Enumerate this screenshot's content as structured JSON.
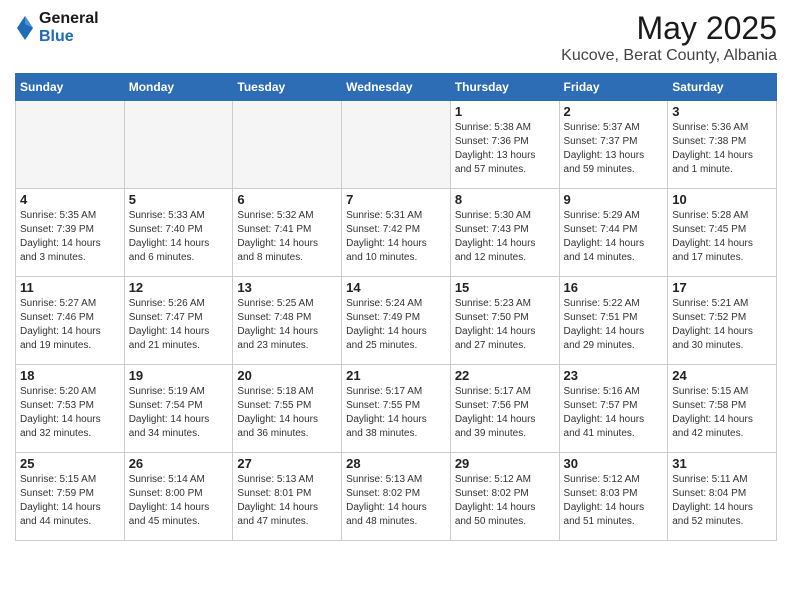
{
  "logo": {
    "general": "General",
    "blue": "Blue"
  },
  "title": {
    "month": "May 2025",
    "location": "Kucove, Berat County, Albania"
  },
  "days_of_week": [
    "Sunday",
    "Monday",
    "Tuesday",
    "Wednesday",
    "Thursday",
    "Friday",
    "Saturday"
  ],
  "weeks": [
    [
      {
        "day": "",
        "info": ""
      },
      {
        "day": "",
        "info": ""
      },
      {
        "day": "",
        "info": ""
      },
      {
        "day": "",
        "info": ""
      },
      {
        "day": "1",
        "info": "Sunrise: 5:38 AM\nSunset: 7:36 PM\nDaylight: 13 hours and 57 minutes."
      },
      {
        "day": "2",
        "info": "Sunrise: 5:37 AM\nSunset: 7:37 PM\nDaylight: 13 hours and 59 minutes."
      },
      {
        "day": "3",
        "info": "Sunrise: 5:36 AM\nSunset: 7:38 PM\nDaylight: 14 hours and 1 minute."
      }
    ],
    [
      {
        "day": "4",
        "info": "Sunrise: 5:35 AM\nSunset: 7:39 PM\nDaylight: 14 hours and 3 minutes."
      },
      {
        "day": "5",
        "info": "Sunrise: 5:33 AM\nSunset: 7:40 PM\nDaylight: 14 hours and 6 minutes."
      },
      {
        "day": "6",
        "info": "Sunrise: 5:32 AM\nSunset: 7:41 PM\nDaylight: 14 hours and 8 minutes."
      },
      {
        "day": "7",
        "info": "Sunrise: 5:31 AM\nSunset: 7:42 PM\nDaylight: 14 hours and 10 minutes."
      },
      {
        "day": "8",
        "info": "Sunrise: 5:30 AM\nSunset: 7:43 PM\nDaylight: 14 hours and 12 minutes."
      },
      {
        "day": "9",
        "info": "Sunrise: 5:29 AM\nSunset: 7:44 PM\nDaylight: 14 hours and 14 minutes."
      },
      {
        "day": "10",
        "info": "Sunrise: 5:28 AM\nSunset: 7:45 PM\nDaylight: 14 hours and 17 minutes."
      }
    ],
    [
      {
        "day": "11",
        "info": "Sunrise: 5:27 AM\nSunset: 7:46 PM\nDaylight: 14 hours and 19 minutes."
      },
      {
        "day": "12",
        "info": "Sunrise: 5:26 AM\nSunset: 7:47 PM\nDaylight: 14 hours and 21 minutes."
      },
      {
        "day": "13",
        "info": "Sunrise: 5:25 AM\nSunset: 7:48 PM\nDaylight: 14 hours and 23 minutes."
      },
      {
        "day": "14",
        "info": "Sunrise: 5:24 AM\nSunset: 7:49 PM\nDaylight: 14 hours and 25 minutes."
      },
      {
        "day": "15",
        "info": "Sunrise: 5:23 AM\nSunset: 7:50 PM\nDaylight: 14 hours and 27 minutes."
      },
      {
        "day": "16",
        "info": "Sunrise: 5:22 AM\nSunset: 7:51 PM\nDaylight: 14 hours and 29 minutes."
      },
      {
        "day": "17",
        "info": "Sunrise: 5:21 AM\nSunset: 7:52 PM\nDaylight: 14 hours and 30 minutes."
      }
    ],
    [
      {
        "day": "18",
        "info": "Sunrise: 5:20 AM\nSunset: 7:53 PM\nDaylight: 14 hours and 32 minutes."
      },
      {
        "day": "19",
        "info": "Sunrise: 5:19 AM\nSunset: 7:54 PM\nDaylight: 14 hours and 34 minutes."
      },
      {
        "day": "20",
        "info": "Sunrise: 5:18 AM\nSunset: 7:55 PM\nDaylight: 14 hours and 36 minutes."
      },
      {
        "day": "21",
        "info": "Sunrise: 5:17 AM\nSunset: 7:55 PM\nDaylight: 14 hours and 38 minutes."
      },
      {
        "day": "22",
        "info": "Sunrise: 5:17 AM\nSunset: 7:56 PM\nDaylight: 14 hours and 39 minutes."
      },
      {
        "day": "23",
        "info": "Sunrise: 5:16 AM\nSunset: 7:57 PM\nDaylight: 14 hours and 41 minutes."
      },
      {
        "day": "24",
        "info": "Sunrise: 5:15 AM\nSunset: 7:58 PM\nDaylight: 14 hours and 42 minutes."
      }
    ],
    [
      {
        "day": "25",
        "info": "Sunrise: 5:15 AM\nSunset: 7:59 PM\nDaylight: 14 hours and 44 minutes."
      },
      {
        "day": "26",
        "info": "Sunrise: 5:14 AM\nSunset: 8:00 PM\nDaylight: 14 hours and 45 minutes."
      },
      {
        "day": "27",
        "info": "Sunrise: 5:13 AM\nSunset: 8:01 PM\nDaylight: 14 hours and 47 minutes."
      },
      {
        "day": "28",
        "info": "Sunrise: 5:13 AM\nSunset: 8:02 PM\nDaylight: 14 hours and 48 minutes."
      },
      {
        "day": "29",
        "info": "Sunrise: 5:12 AM\nSunset: 8:02 PM\nDaylight: 14 hours and 50 minutes."
      },
      {
        "day": "30",
        "info": "Sunrise: 5:12 AM\nSunset: 8:03 PM\nDaylight: 14 hours and 51 minutes."
      },
      {
        "day": "31",
        "info": "Sunrise: 5:11 AM\nSunset: 8:04 PM\nDaylight: 14 hours and 52 minutes."
      }
    ]
  ]
}
